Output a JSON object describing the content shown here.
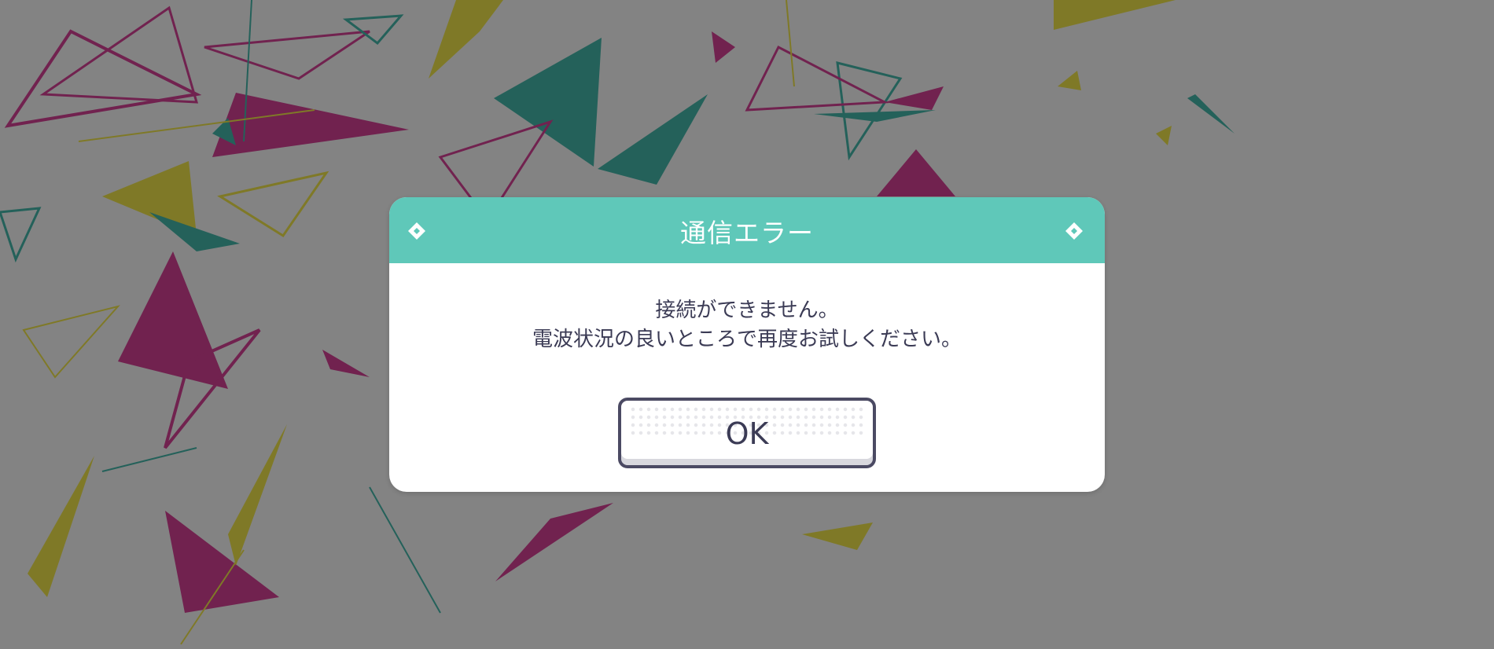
{
  "background": {
    "description_icon": "triangle-confetti-pattern",
    "colors": {
      "teal": "#43b3a6",
      "magenta": "#d13f92",
      "yellow": "#ebe048",
      "overlay": "rgba(0,0,0,0.46)"
    }
  },
  "dialog": {
    "title": "通信エラー",
    "header_color": "#5fc8b9",
    "header_icon_left": "diamond-icon",
    "header_icon_right": "diamond-icon",
    "message_lines": [
      "接続ができません。",
      "電波状況の良いところで再度お試しください。"
    ],
    "ok_label": "OK"
  }
}
